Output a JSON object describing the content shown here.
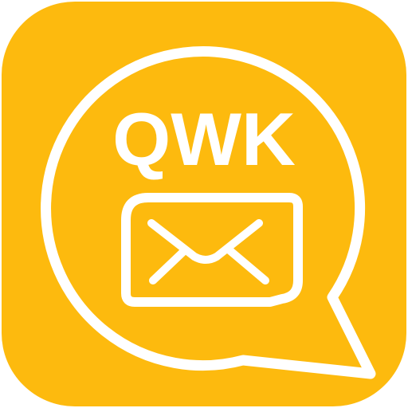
{
  "app_icon": {
    "label": "QWK",
    "colors": {
      "background": "#FDBA0E",
      "foreground": "#FFFFFF"
    },
    "icons": {
      "bubble": "speech-bubble-icon",
      "envelope": "envelope-icon"
    }
  }
}
